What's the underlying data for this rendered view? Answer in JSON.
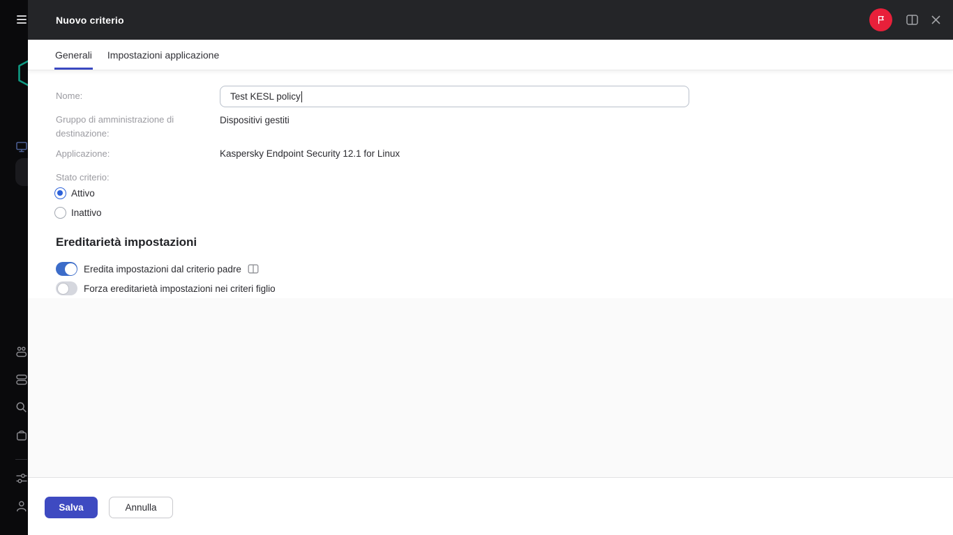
{
  "header": {
    "title": "Nuovo criterio",
    "icons": [
      "flag-icon",
      "book-icon",
      "close-icon"
    ]
  },
  "tabs": [
    {
      "label": "Generali",
      "active": true
    },
    {
      "label": "Impostazioni applicazione",
      "active": false
    }
  ],
  "form": {
    "name": {
      "label": "Nome:",
      "value": "Test KESL policy"
    },
    "group": {
      "label": "Gruppo di amministrazione di destinazione:",
      "value": "Dispositivi gestiti"
    },
    "application": {
      "label": "Applicazione:",
      "value": "Kaspersky Endpoint Security 12.1 for Linux"
    },
    "status": {
      "label": "Stato criterio:",
      "options": [
        {
          "label": "Attivo",
          "selected": true
        },
        {
          "label": "Inattivo",
          "selected": false
        }
      ]
    }
  },
  "inheritance": {
    "heading": "Ereditarietà impostazioni",
    "toggles": [
      {
        "label": "Eredita impostazioni dal criterio padre",
        "on": true,
        "help_icon": "book-icon"
      },
      {
        "label": "Forza ereditarietà impostazioni nei criteri figlio",
        "on": false
      }
    ]
  },
  "footer": {
    "save_label": "Salva",
    "cancel_label": "Annulla"
  },
  "sidebar": {
    "icons": [
      "menu-icon",
      "kaspersky-logo",
      "monitoring-icon",
      "devices-icon",
      "servers-icon",
      "search-icon",
      "marketplace-icon",
      "settings-icon",
      "account-icon"
    ]
  },
  "colors": {
    "accent_indigo": "#3e4ac1",
    "tab_underline": "#3a49c1",
    "radio_blue": "#2d62d9",
    "toggle_blue": "#3c6cc9",
    "flag_red": "#e8203a",
    "logo_teal": "#0f9a83",
    "topbar_bg": "#242528",
    "sidebar_bg": "#0a0a0c"
  }
}
